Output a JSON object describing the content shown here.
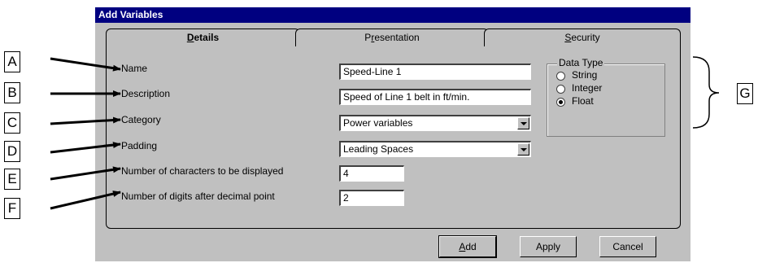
{
  "dialog": {
    "title": "Add Variables",
    "tabs": [
      {
        "prefix": "",
        "mnemonic": "D",
        "rest": "etails",
        "active": true
      },
      {
        "prefix": "P",
        "mnemonic": "r",
        "rest": "esentation",
        "active": false
      },
      {
        "prefix": "",
        "mnemonic": "S",
        "rest": "ecurity",
        "active": false
      }
    ],
    "labels": {
      "name": "Name",
      "description": "Description",
      "category": "Category",
      "padding": "Padding",
      "num_chars": "Number of characters to be displayed",
      "num_digits": "Number of digits after decimal point"
    },
    "fields": {
      "name": "Speed-Line 1",
      "description": "Speed of Line 1 belt in ft/min.",
      "category": "Power variables",
      "padding": "Leading Spaces",
      "num_chars": "4",
      "num_digits": "2"
    },
    "data_type": {
      "title": "Data Type",
      "options": [
        "String",
        "Integer",
        "Float"
      ],
      "selected": "Float"
    },
    "buttons": {
      "add_mnemonic": "A",
      "add_rest": "dd",
      "apply": "Apply",
      "cancel": "Cancel"
    }
  },
  "callouts": [
    "A",
    "B",
    "C",
    "D",
    "E",
    "F",
    "G"
  ]
}
